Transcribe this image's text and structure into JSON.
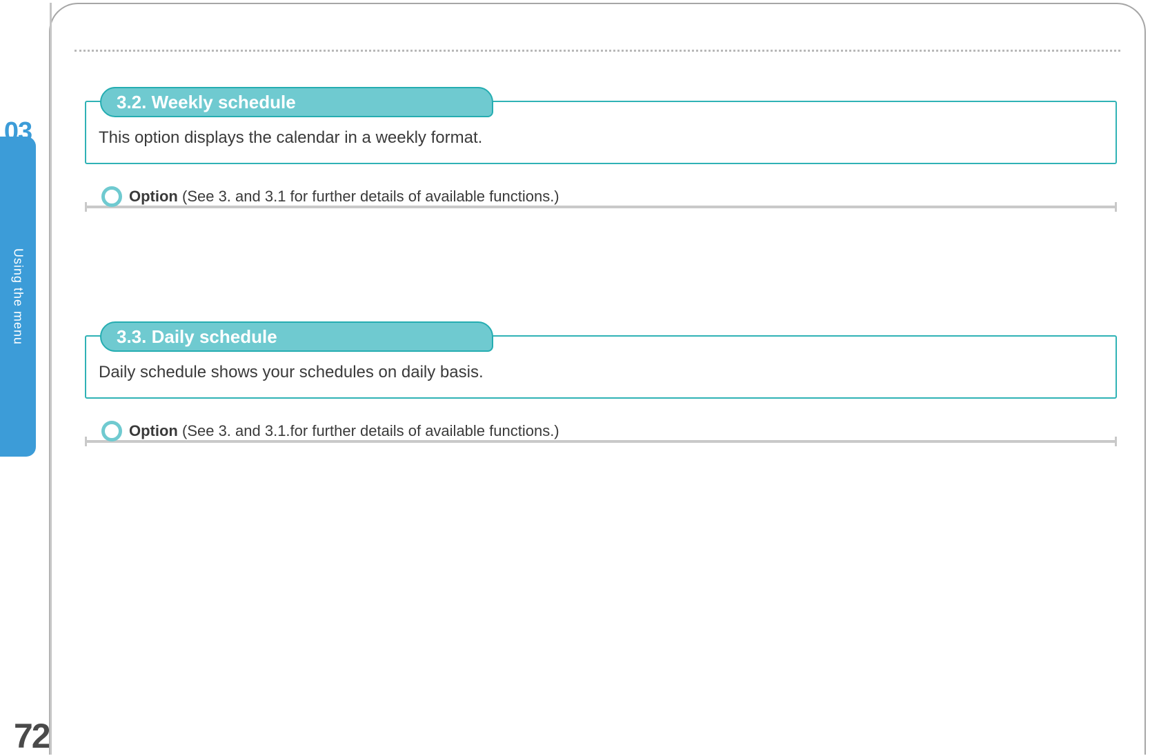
{
  "chapter_number": "03",
  "side_tab_label": "Using the menu",
  "page_number": "72",
  "sections": [
    {
      "heading": "3.2. Weekly schedule",
      "body": "This option displays the calendar in a weekly format.",
      "option_label": "Option",
      "option_note": " (See 3. and 3.1 for further details of available functions.)"
    },
    {
      "heading": "3.3. Daily schedule",
      "body": "Daily schedule shows your schedules on daily basis.",
      "option_label": "Option",
      "option_note": " (See 3. and 3.1.for further details of available functions.)"
    }
  ]
}
